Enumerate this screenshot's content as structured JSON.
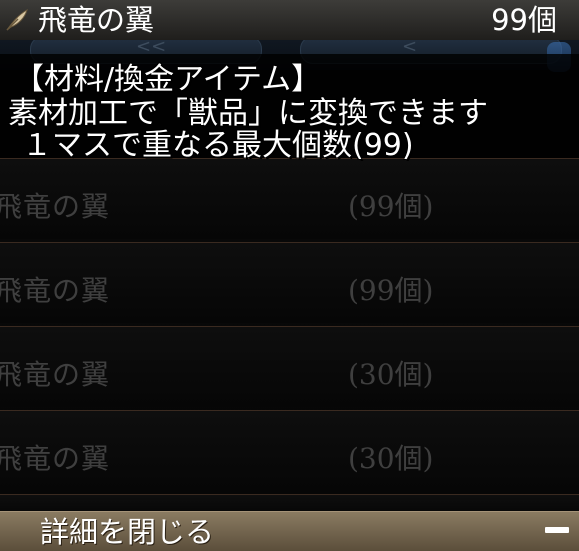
{
  "header": {
    "icon": "feather-icon",
    "title": "飛竜の翼",
    "quantity": "99個"
  },
  "tabs": {
    "prev_arrow": "<<",
    "next_arrow": "<"
  },
  "description": {
    "category": "【材料/換金アイテム】",
    "line1": "素材加工で「獣品」に変換できます",
    "line2": "１マスで重なる最大個数(99)"
  },
  "list": {
    "items": [
      {
        "name": "飛竜の翼",
        "quantity": "(99個)"
      },
      {
        "name": "飛竜の翼",
        "quantity": "(99個)"
      },
      {
        "name": "飛竜の翼",
        "quantity": "(30個)"
      },
      {
        "name": "飛竜の翼",
        "quantity": "(30個)"
      }
    ]
  },
  "footer": {
    "label": "詳細を閉じる",
    "toggle_icon": "minus-icon"
  },
  "colors": {
    "header_bg": "#3d3c39",
    "footer_bg": "#8a7b62",
    "row_separator": "#3a2a20",
    "dim_text": "#3f3f3f"
  }
}
